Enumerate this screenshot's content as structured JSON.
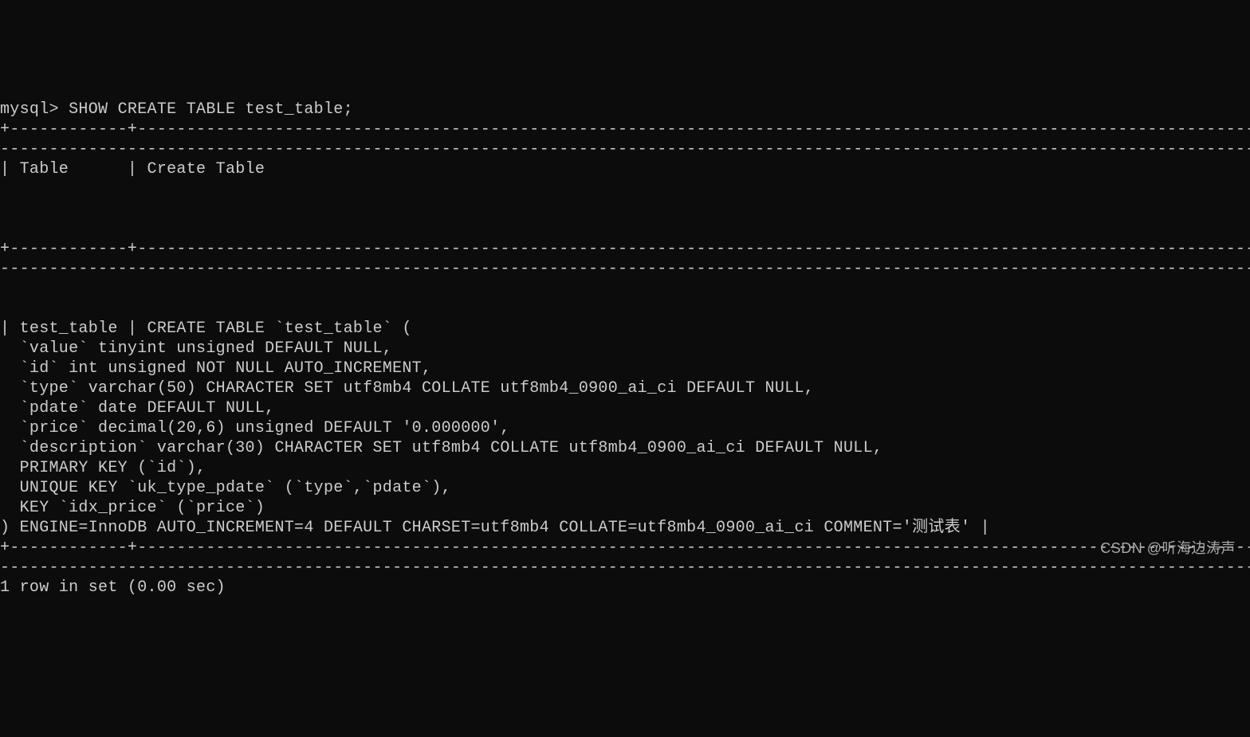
{
  "terminal": {
    "prompt": "mysql> ",
    "command": "SHOW CREATE TABLE test_table;",
    "separator_top": "+------------+--------------------------------------------------------------------------------------------------------------------------------------------------------------",
    "separator_top2": "--------------------------------------------------------------------------------------------------------------------------------------------------------------------------------+",
    "header_col1": "| Table      | Create Table",
    "header_spacer": "                                                                                                                                                                                 |",
    "separator_mid": "+------------+--------------------------------------------------------------------------------------------------------------------------------------------------------------",
    "separator_mid2": "--------------------------------------------------------------------------------------------------------------------------------------------------------------------------------+",
    "data_line1": "| test_table | CREATE TABLE `test_table` (",
    "data_line2": "  `value` tinyint unsigned DEFAULT NULL,",
    "data_line3": "  `id` int unsigned NOT NULL AUTO_INCREMENT,",
    "data_line4": "  `type` varchar(50) CHARACTER SET utf8mb4 COLLATE utf8mb4_0900_ai_ci DEFAULT NULL,",
    "data_line5": "  `pdate` date DEFAULT NULL,",
    "data_line6": "  `price` decimal(20,6) unsigned DEFAULT '0.000000',",
    "data_line7": "  `description` varchar(30) CHARACTER SET utf8mb4 COLLATE utf8mb4_0900_ai_ci DEFAULT NULL,",
    "data_line8": "  PRIMARY KEY (`id`),",
    "data_line9": "  UNIQUE KEY `uk_type_pdate` (`type`,`pdate`),",
    "data_line10": "  KEY `idx_price` (`price`)",
    "data_line11": ") ENGINE=InnoDB AUTO_INCREMENT=4 DEFAULT CHARSET=utf8mb4 COLLATE=utf8mb4_0900_ai_ci COMMENT='测试表' |",
    "separator_bot": "+------------+--------------------------------------------------------------------------------------------------------------------------------------------------------------",
    "separator_bot2": "--------------------------------------------------------------------------------------------------------------------------------------------------------------------------------+",
    "result": "1 row in set (0.00 sec)"
  },
  "watermark": "CSDN @听海边涛声"
}
